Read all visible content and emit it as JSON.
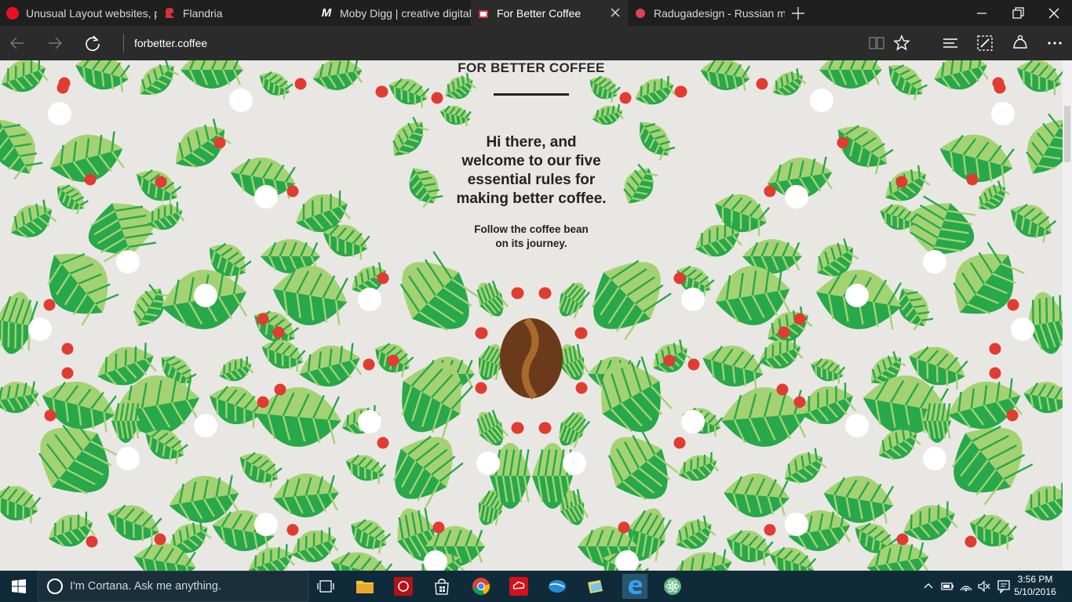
{
  "browser": {
    "tabs": [
      {
        "title": "Unusual Layout websites, pa",
        "favicon": "red-circle-icon",
        "color": "#e81123"
      },
      {
        "title": "Flandria",
        "favicon": "flandria-icon",
        "color": "#d13438"
      },
      {
        "title": "Moby Digg | creative digital",
        "favicon": "moby-m-icon",
        "color": "#ffffff"
      },
      {
        "title": "For Better Coffee",
        "favicon": "coffee-favicon",
        "color": "#d13438",
        "active": true
      },
      {
        "title": "Radugadesign - Russian me",
        "favicon": "raduga-icon",
        "color": "#e0405a"
      }
    ],
    "address": "forbetter.coffee"
  },
  "page": {
    "brand": "FOR BETTER COFFEE",
    "headline_lines": [
      "Hi there, and",
      "welcome to our five",
      "essential rules for",
      "making better coffee."
    ],
    "subline_lines": [
      "Follow the coffee bean",
      "on its journey."
    ],
    "colors": {
      "background": "#e9e7e3",
      "leaf_dark": "#27a84a",
      "leaf_light": "#a4d272",
      "berry": "#e03c31",
      "bean": "#6b3a1a",
      "bean_seam": "#a86a2c"
    }
  },
  "taskbar": {
    "search_placeholder": "I'm Cortana. Ask me anything.",
    "time": "3:56 PM",
    "date": "5/10/2016",
    "apps": [
      "task-view-icon",
      "file-explorer-icon",
      "app-red-icon",
      "store-icon",
      "chrome-icon",
      "creative-cloud-icon",
      "mail-icon",
      "photos-icon",
      "edge-icon",
      "atom-icon"
    ]
  }
}
